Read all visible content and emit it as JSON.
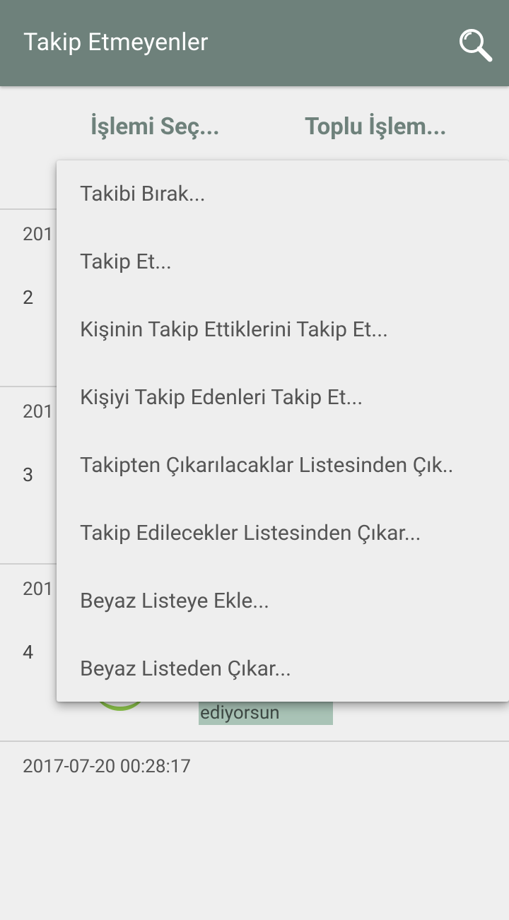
{
  "appbar": {
    "title": "Takip Etmeyenler",
    "search_icon": "search-icon"
  },
  "actions": {
    "select_label": "İşlemi Seç...",
    "bulk_label": "Toplu İşlem..."
  },
  "rows": [
    {
      "date": "201",
      "number": "2"
    },
    {
      "date": "201",
      "number": "3"
    },
    {
      "date": "201",
      "number": "4",
      "tag": "ediyorsun"
    },
    {
      "date": "2017-07-20 00:28:17"
    }
  ],
  "menu": {
    "items": [
      "Takibi Bırak...",
      "Takip Et...",
      "Kişinin Takip Ettiklerini Takip Et...",
      "Kişiyi Takip Edenleri Takip Et...",
      "Takipten Çıkarılacaklar Listesinden Çık..",
      "Takip Edilecekler Listesinden Çıkar...",
      "Beyaz Listeye Ekle...",
      "Beyaz Listeden Çıkar..."
    ]
  },
  "colors": {
    "primary": "#6e817b",
    "background": "#efefef",
    "menu": "#eeeeee",
    "tag": "#a9c3b6",
    "accent_green": "#8bc34a"
  }
}
